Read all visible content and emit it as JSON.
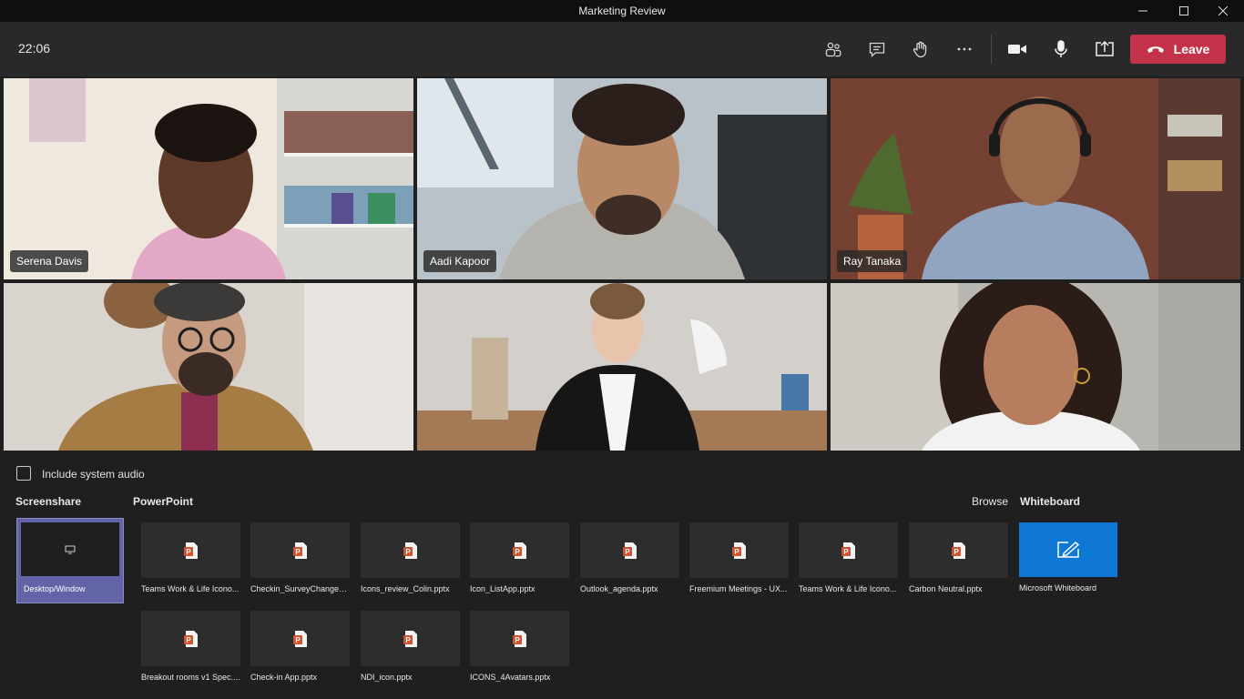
{
  "window": {
    "title": "Marketing Review"
  },
  "toolbar": {
    "time": "22:06",
    "leave_label": "Leave",
    "icons": [
      "participants-icon",
      "chat-icon",
      "raise-hand-icon",
      "more-options-icon",
      "camera-icon",
      "microphone-icon",
      "share-tray-icon",
      "phone-hangup-icon"
    ]
  },
  "participants": [
    {
      "name": "Serena Davis"
    },
    {
      "name": "Aadi Kapoor"
    },
    {
      "name": "Ray Tanaka"
    },
    {
      "name": ""
    },
    {
      "name": ""
    },
    {
      "name": ""
    }
  ],
  "share_tray": {
    "include_audio_label": "Include system audio",
    "include_audio_checked": false,
    "screenshare_heading": "Screenshare",
    "desktop_label": "Desktop/Window",
    "powerpoint_heading": "PowerPoint",
    "browse_label": "Browse",
    "whiteboard_heading": "Whiteboard",
    "whiteboard_label": "Microsoft Whiteboard",
    "files": [
      "Teams Work & Life Icono...",
      "Checkin_SurveyChanges....",
      "Icons_review_Colin.pptx",
      "Icon_ListApp.pptx",
      "Outlook_agenda.pptx",
      "Freemium Meetings - UX...",
      "Teams Work & Life Icono...",
      "Carbon Neutral.pptx",
      "Breakout rooms v1 Spec....",
      "Check-in App.pptx",
      "NDI_icon.pptx",
      "ICONS_4Avatars.pptx"
    ]
  },
  "colors": {
    "accent": "#6264a7",
    "leave": "#c4314b",
    "whiteboard": "#0f78d4",
    "powerpoint": "#d35230"
  }
}
